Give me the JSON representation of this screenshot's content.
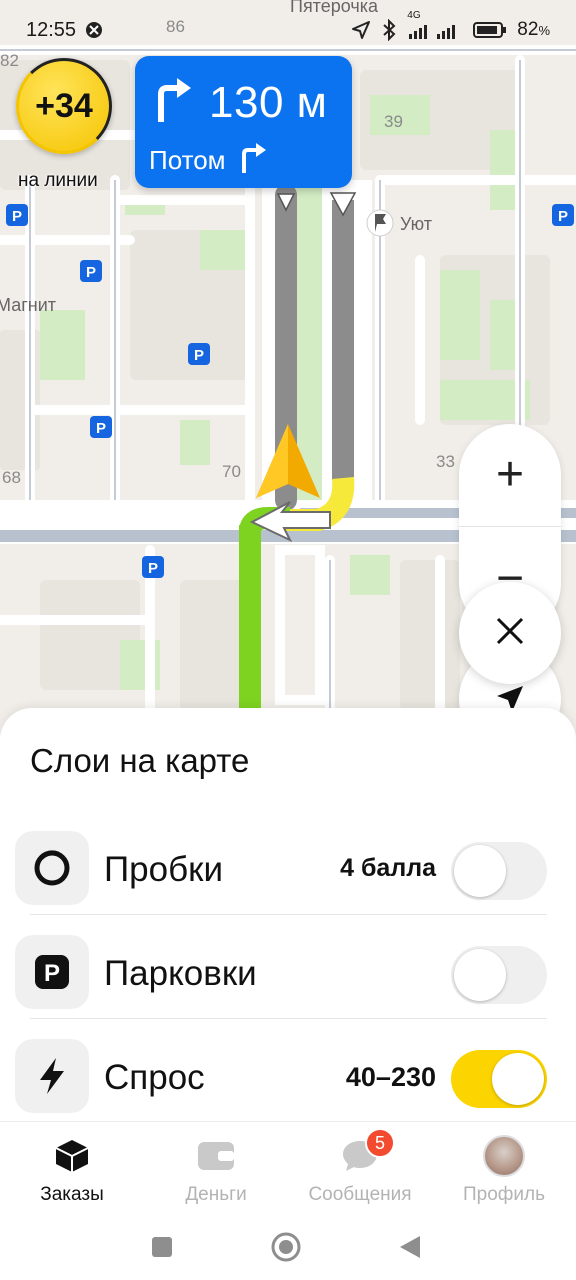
{
  "status_bar": {
    "time": "12:55",
    "battery": "82",
    "battery_unit": "%",
    "network": "4G",
    "icons": [
      "alarm-icon",
      "location-arrow-icon",
      "bluetooth-icon",
      "signal-icon",
      "battery-icon"
    ]
  },
  "map": {
    "labels": {
      "shop_top": "Пятерочка",
      "shop_left": "Магнит",
      "place": "Уют",
      "house_86": "86",
      "house_39": "39",
      "house_82": "82",
      "house_70": "70",
      "house_68": "68",
      "house_33": "33"
    },
    "parking_symbol": "P"
  },
  "earnings": {
    "value": "+34",
    "status": "на линии"
  },
  "maneuver": {
    "distance": "130 м",
    "next_label": "Потом"
  },
  "controls": {
    "zoom_in": "+",
    "zoom_out": "−"
  },
  "layers": {
    "title": "Слои на карте",
    "items": [
      {
        "label": "Пробки",
        "value": "4 балла",
        "icon": "traffic-icon",
        "enabled": false
      },
      {
        "label": "Парковки",
        "value": "",
        "icon": "parking-icon",
        "enabled": false
      },
      {
        "label": "Спрос",
        "value": "40–230",
        "icon": "lightning-icon",
        "enabled": true
      }
    ]
  },
  "bottom_nav": {
    "items": [
      {
        "label": "Заказы",
        "icon": "orders-box-icon",
        "active": true
      },
      {
        "label": "Деньги",
        "icon": "wallet-icon",
        "active": false
      },
      {
        "label": "Сообщения",
        "icon": "chat-bubble-icon",
        "active": false,
        "badge": "5"
      },
      {
        "label": "Профиль",
        "icon": "avatar",
        "active": false
      }
    ]
  },
  "colors": {
    "accent_blue": "#0b73f0",
    "accent_yellow": "#fcd400",
    "route_green": "#7ed321",
    "badge_red": "#f24b30"
  }
}
